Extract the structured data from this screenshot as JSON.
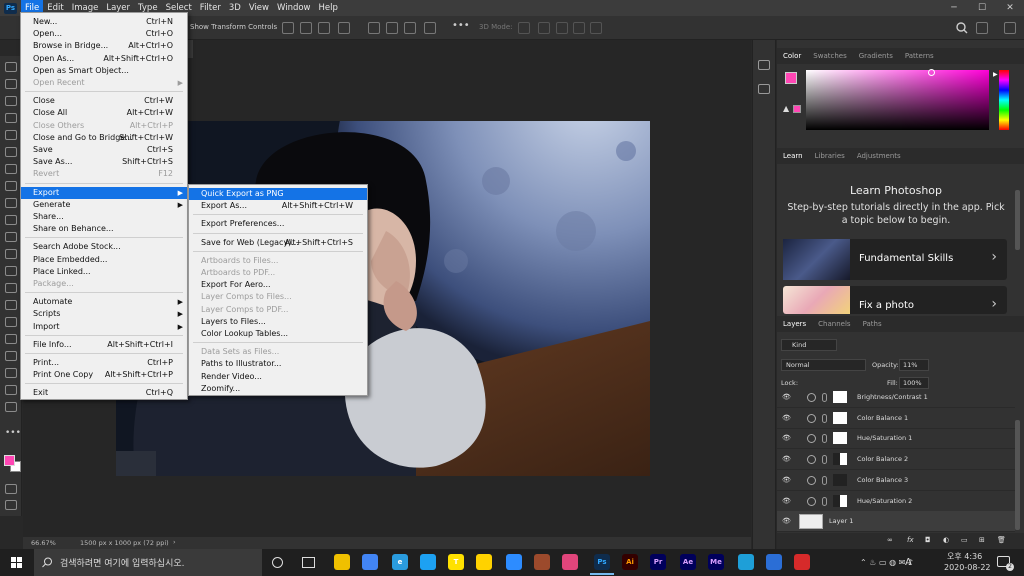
{
  "app": {
    "logo": "Ps"
  },
  "menubar": {
    "items": [
      "File",
      "Edit",
      "Image",
      "Layer",
      "Type",
      "Select",
      "Filter",
      "3D",
      "View",
      "Window",
      "Help"
    ],
    "active": "File"
  },
  "options_bar": {
    "show_transform": "Show Transform Controls",
    "mode3d": "3D Mode:"
  },
  "file_menu": [
    {
      "label": "New...",
      "shortcut": "Ctrl+N"
    },
    {
      "label": "Open...",
      "shortcut": "Ctrl+O"
    },
    {
      "label": "Browse in Bridge...",
      "shortcut": "Alt+Ctrl+O"
    },
    {
      "label": "Open As...",
      "shortcut": "Alt+Shift+Ctrl+O"
    },
    {
      "label": "Open as Smart Object..."
    },
    {
      "label": "Open Recent",
      "disabled": true,
      "submenu": true
    },
    {
      "sep": true
    },
    {
      "label": "Close",
      "shortcut": "Ctrl+W"
    },
    {
      "label": "Close All",
      "shortcut": "Alt+Ctrl+W"
    },
    {
      "label": "Close Others",
      "shortcut": "Alt+Ctrl+P",
      "disabled": true
    },
    {
      "label": "Close and Go to Bridge...",
      "shortcut": "Shift+Ctrl+W"
    },
    {
      "label": "Save",
      "shortcut": "Ctrl+S"
    },
    {
      "label": "Save As...",
      "shortcut": "Shift+Ctrl+S"
    },
    {
      "label": "Revert",
      "shortcut": "F12",
      "disabled": true
    },
    {
      "sep": true
    },
    {
      "label": "Export",
      "submenu": true,
      "highlight": true
    },
    {
      "label": "Generate",
      "submenu": true
    },
    {
      "label": "Share..."
    },
    {
      "label": "Share on Behance..."
    },
    {
      "sep": true
    },
    {
      "label": "Search Adobe Stock..."
    },
    {
      "label": "Place Embedded..."
    },
    {
      "label": "Place Linked..."
    },
    {
      "label": "Package...",
      "disabled": true
    },
    {
      "sep": true
    },
    {
      "label": "Automate",
      "submenu": true
    },
    {
      "label": "Scripts",
      "submenu": true
    },
    {
      "label": "Import",
      "submenu": true
    },
    {
      "sep": true
    },
    {
      "label": "File Info...",
      "shortcut": "Alt+Shift+Ctrl+I"
    },
    {
      "sep": true
    },
    {
      "label": "Print...",
      "shortcut": "Ctrl+P"
    },
    {
      "label": "Print One Copy",
      "shortcut": "Alt+Shift+Ctrl+P"
    },
    {
      "sep": true
    },
    {
      "label": "Exit",
      "shortcut": "Ctrl+Q"
    }
  ],
  "export_menu": [
    {
      "label": "Quick Export as PNG",
      "highlight": true
    },
    {
      "label": "Export As...",
      "shortcut": "Alt+Shift+Ctrl+W"
    },
    {
      "sep": true
    },
    {
      "label": "Export Preferences..."
    },
    {
      "sep": true
    },
    {
      "label": "Save for Web (Legacy)...",
      "shortcut": "Alt+Shift+Ctrl+S"
    },
    {
      "sep": true
    },
    {
      "label": "Artboards to Files...",
      "disabled": true
    },
    {
      "label": "Artboards to PDF...",
      "disabled": true
    },
    {
      "label": "Export For Aero..."
    },
    {
      "label": "Layer Comps to Files...",
      "disabled": true
    },
    {
      "label": "Layer Comps to PDF...",
      "disabled": true
    },
    {
      "label": "Layers to Files..."
    },
    {
      "label": "Color Lookup Tables..."
    },
    {
      "sep": true
    },
    {
      "label": "Data Sets as Files...",
      "disabled": true
    },
    {
      "label": "Paths to Illustrator..."
    },
    {
      "label": "Render Video..."
    },
    {
      "label": "Zoomify..."
    }
  ],
  "status": {
    "zoom": "66.67%",
    "doc": "1500 px x 1000 px (72 ppi)"
  },
  "color_panel": {
    "tabs": [
      "Color",
      "Swatches",
      "Gradients",
      "Patterns"
    ],
    "active": "Color",
    "fg": "#ff47b4"
  },
  "learn_panel": {
    "tabs": [
      "Learn",
      "Libraries",
      "Adjustments"
    ],
    "active": "Learn",
    "title": "Learn Photoshop",
    "desc": "Step-by-step tutorials directly in the app. Pick a topic below to begin.",
    "cards": [
      "Fundamental Skills",
      "Fix a photo"
    ]
  },
  "layers_panel": {
    "tabs": [
      "Layers",
      "Channels",
      "Paths"
    ],
    "active": "Layers",
    "kind": "Kind",
    "blend": "Normal",
    "opacity_label": "Opacity:",
    "opacity": "11%",
    "lock_label": "Lock:",
    "fill_label": "Fill:",
    "fill": "100%",
    "layers": [
      "Brightness/Contrast 1",
      "Color Balance 1",
      "Hue/Saturation 1",
      "Color Balance 2",
      "Color Balance 3",
      "Hue/Saturation 2",
      "Layer 1"
    ]
  },
  "taskbar": {
    "search_placeholder": "검색하려면 여기에 입력하십시오.",
    "time": "오후 4:36",
    "date": "2020-08-22",
    "lang": "A",
    "notif": "2"
  }
}
